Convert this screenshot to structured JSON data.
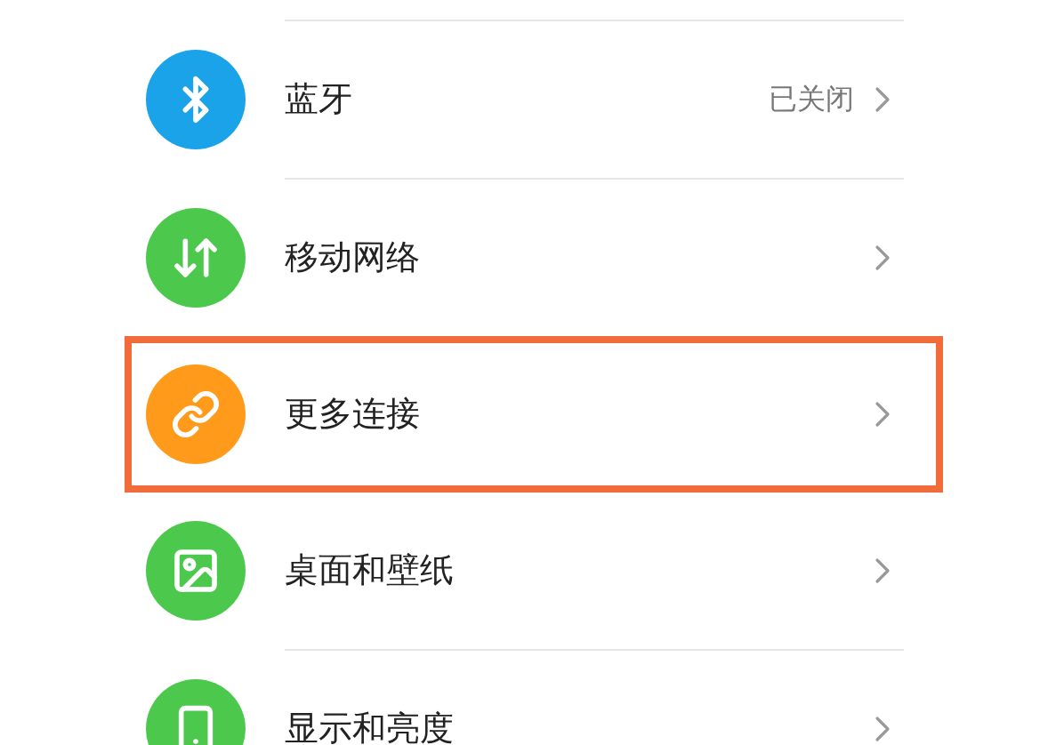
{
  "settings_items": [
    {
      "kind": "bluetooth",
      "label": "蓝牙",
      "value": "已关闭",
      "color": "#1aa3e8",
      "highlighted": false
    },
    {
      "kind": "network",
      "label": "移动网络",
      "color": "#4cc94c",
      "highlighted": false
    },
    {
      "kind": "link",
      "label": "更多连接",
      "color": "#ff9a1a",
      "highlighted": true
    },
    {
      "kind": "image",
      "label": "桌面和壁纸",
      "color": "#4cc94c",
      "highlighted": false
    },
    {
      "kind": "display",
      "label": "显示和亮度",
      "color": "#4cc94c",
      "highlighted": false
    }
  ]
}
